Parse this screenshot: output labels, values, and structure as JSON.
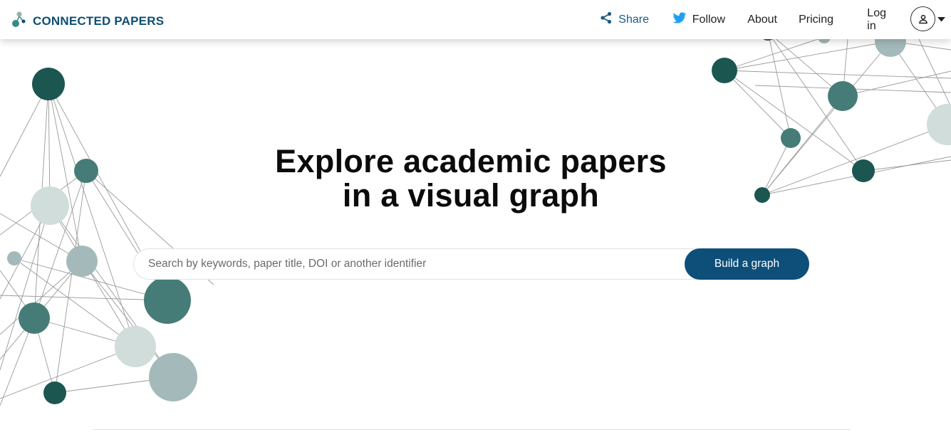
{
  "brand": {
    "name": "CONNECTED PAPERS",
    "logo_icon": "molecule-logo-icon"
  },
  "nav": {
    "share": "Share",
    "follow": "Follow",
    "about": "About",
    "pricing": "Pricing",
    "login": "Log in"
  },
  "icons": {
    "share": "share-icon",
    "follow": "twitter-bird-icon",
    "user": "user-avatar-icon",
    "menu": "caret-down-icon"
  },
  "hero": {
    "title_line1": "Explore academic papers",
    "title_line2": "in a visual graph"
  },
  "search": {
    "placeholder": "Search by keywords, paper title, DOI or another identifier",
    "value": "",
    "button_label": "Build a graph"
  },
  "colors": {
    "brand": "#0e4f72",
    "button": "#0e4f7a",
    "twitter": "#1da1f2",
    "node_dark": "#1b5651",
    "node_mid": "#467c77",
    "node_light": "#a4b9b9",
    "node_pale": "#d0dddb"
  }
}
